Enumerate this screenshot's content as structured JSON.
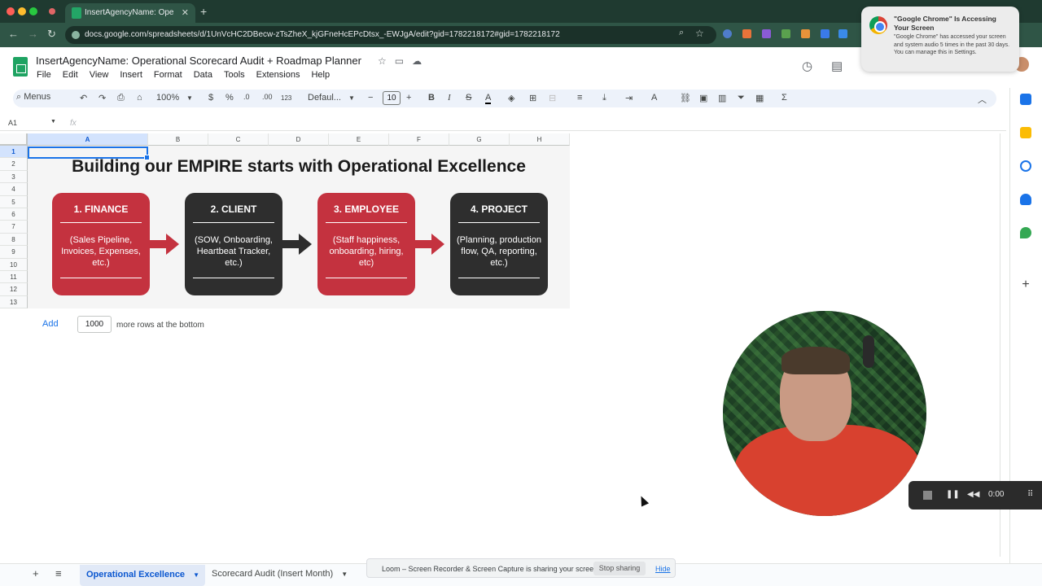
{
  "browser": {
    "tab_title": "InsertAgencyName: Ope",
    "url": "docs.google.com/spreadsheets/d/1UnVcHC2DBecw-zTsZheX_kjGFneHcEPcDtsx_-EWJgA/edit?gid=1782218172#gid=1782218172"
  },
  "notification": {
    "title": "\"Google Chrome\" Is Accessing Your Screen",
    "body": "\"Google Chrome\" has accessed your screen and system audio 5 times in the past 30 days. You can manage this in Settings."
  },
  "sheet": {
    "title": "InsertAgencyName: Operational Scorecard Audit + Roadmap Planner",
    "menu": [
      "File",
      "Edit",
      "View",
      "Insert",
      "Format",
      "Data",
      "Tools",
      "Extensions",
      "Help"
    ],
    "toolbar": {
      "menus": "Menus",
      "zoom": "100%",
      "currency": "$",
      "percent": "%",
      "dec_dec": ".0",
      "dec_inc": ".00",
      "format_num": "123",
      "font": "Defaul...",
      "font_size": "10",
      "bold": "B",
      "italic": "I"
    },
    "name_box": "A1",
    "fx": "fx",
    "columns": [
      "A",
      "B",
      "C",
      "D",
      "E",
      "F",
      "G",
      "H"
    ],
    "rows": [
      "1",
      "2",
      "3",
      "4",
      "5",
      "6",
      "7",
      "8",
      "9",
      "10",
      "11",
      "12",
      "13"
    ]
  },
  "content": {
    "heading": "Building our EMPIRE starts with Operational Excellence",
    "cards": [
      {
        "title": "1. FINANCE",
        "body": "(Sales Pipeline, Invoices, Expenses, etc.)",
        "color": "#c4323f"
      },
      {
        "title": "2. CLIENT",
        "body": "(SOW, Onboarding, Heartbeat Tracker, etc.)",
        "color": "#2e2e2e"
      },
      {
        "title": "3. EMPLOYEE",
        "body": "(Staff happiness, onboarding, hiring, etc)",
        "color": "#c4323f"
      },
      {
        "title": "4. PROJECT",
        "body": "(Planning, production flow, QA, reporting, etc.)",
        "color": "#2e2e2e"
      }
    ]
  },
  "add_rows": {
    "button": "Add",
    "count": "1000",
    "label": "more rows at the bottom"
  },
  "sheet_tabs": {
    "active": "Operational Excellence",
    "other": "Scorecard Audit (Insert Month)"
  },
  "loom": {
    "message": "Loom – Screen Recorder & Screen Capture is sharing your screen.",
    "stop": "Stop sharing",
    "hide": "Hide"
  },
  "recording": {
    "time": "0:00"
  }
}
